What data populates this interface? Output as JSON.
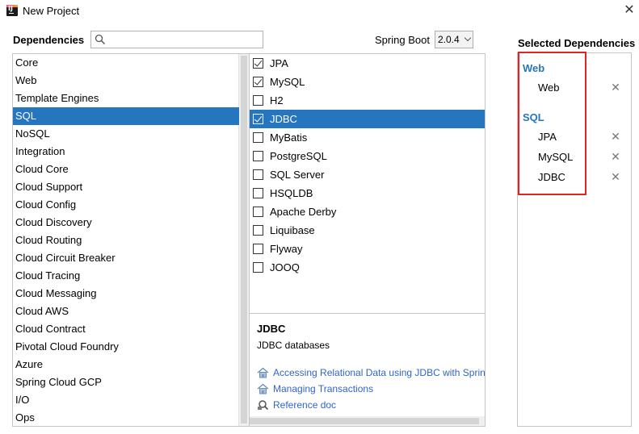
{
  "window": {
    "title": "New Project",
    "close_glyph": "✕"
  },
  "toolbar": {
    "dependencies_label": "Dependencies",
    "search_value": "",
    "search_placeholder": "",
    "spring_boot_label": "Spring Boot",
    "spring_boot_version": "2.0.4"
  },
  "categories": [
    "Core",
    "Web",
    "Template Engines",
    "SQL",
    "NoSQL",
    "Integration",
    "Cloud Core",
    "Cloud Support",
    "Cloud Config",
    "Cloud Discovery",
    "Cloud Routing",
    "Cloud Circuit Breaker",
    "Cloud Tracing",
    "Cloud Messaging",
    "Cloud AWS",
    "Cloud Contract",
    "Pivotal Cloud Foundry",
    "Azure",
    "Spring Cloud GCP",
    "I/O",
    "Ops"
  ],
  "selected_category": "SQL",
  "dependencies": [
    {
      "name": "JPA",
      "checked": true
    },
    {
      "name": "MySQL",
      "checked": true
    },
    {
      "name": "H2",
      "checked": false
    },
    {
      "name": "JDBC",
      "checked": true
    },
    {
      "name": "MyBatis",
      "checked": false
    },
    {
      "name": "PostgreSQL",
      "checked": false
    },
    {
      "name": "SQL Server",
      "checked": false
    },
    {
      "name": "HSQLDB",
      "checked": false
    },
    {
      "name": "Apache Derby",
      "checked": false
    },
    {
      "name": "Liquibase",
      "checked": false
    },
    {
      "name": "Flyway",
      "checked": false
    },
    {
      "name": "JOOQ",
      "checked": false
    }
  ],
  "selected_dependency": "JDBC",
  "description": {
    "title": "JDBC",
    "text": "JDBC databases",
    "links": [
      {
        "label": "Accessing Relational Data using JDBC with Spring",
        "icon": "guide-icon"
      },
      {
        "label": "Managing Transactions",
        "icon": "guide-icon"
      },
      {
        "label": "Reference doc",
        "icon": "reference-icon"
      }
    ]
  },
  "selected_panel": {
    "title": "Selected Dependencies",
    "remove_glyph": "✕",
    "groups": [
      {
        "name": "Web",
        "items": [
          "Web"
        ]
      },
      {
        "name": "SQL",
        "items": [
          "JPA",
          "MySQL",
          "JDBC"
        ]
      }
    ],
    "highlight_color": "#e02424"
  },
  "colors": {
    "selection": "#2675bf",
    "link": "#2f65ca",
    "group_header": "#2675bf"
  }
}
